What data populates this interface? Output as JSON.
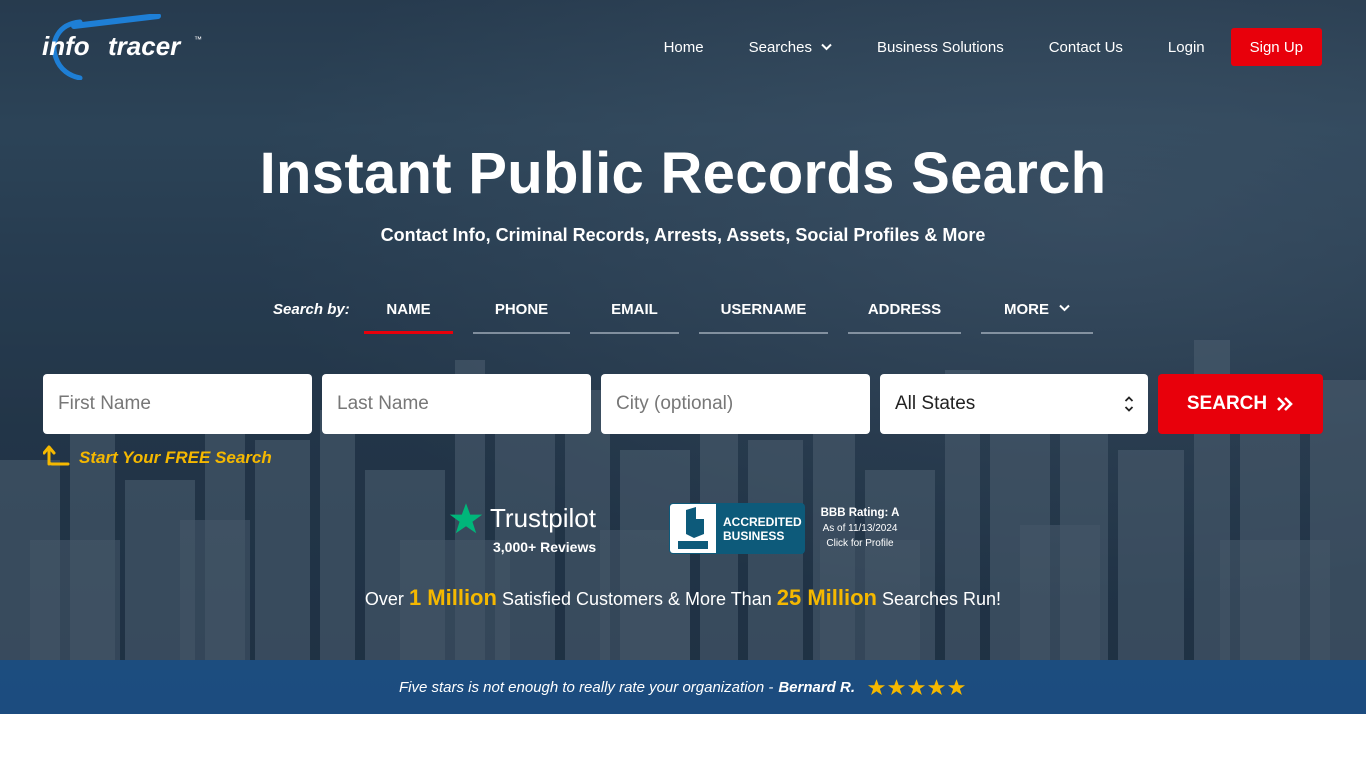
{
  "brand": {
    "logo_left": "info",
    "logo_right": "tracer",
    "tm": "™"
  },
  "nav": {
    "home": "Home",
    "searches": "Searches",
    "business": "Business Solutions",
    "contact": "Contact Us",
    "login": "Login",
    "signup": "Sign Up"
  },
  "hero": {
    "title": "Instant Public Records Search",
    "subtitle": "Contact Info, Criminal Records, Arrests, Assets, Social Profiles & More"
  },
  "search_tabs": {
    "label": "Search by:",
    "items": [
      "NAME",
      "PHONE",
      "EMAIL",
      "USERNAME",
      "ADDRESS",
      "MORE"
    ],
    "active": "NAME"
  },
  "form": {
    "first_name_placeholder": "First Name",
    "last_name_placeholder": "Last Name",
    "city_placeholder": "City (optional)",
    "state_selected": "All States",
    "search_label": "SEARCH",
    "free_hint": "Start Your FREE Search"
  },
  "trust": {
    "trustpilot_name": "Trustpilot",
    "trustpilot_reviews": "3,000+ Reviews",
    "bbb_line1": "ACCREDITED",
    "bbb_line2": "BUSINESS",
    "bbb_rating": "BBB Rating: A",
    "bbb_date": "As of 11/13/2024",
    "bbb_click": "Click for Profile"
  },
  "stats": {
    "pre": "Over ",
    "customers_big": "1 Million",
    "mid": " Satisfied Customers & More Than ",
    "searches_big": "25 Million",
    "post": " Searches Run!"
  },
  "testimonial": {
    "quote": "Five stars is not enough to really rate your organization - ",
    "author": "Bernard R.",
    "stars": 5
  },
  "colors": {
    "accent_red": "#e8000b",
    "highlight_yellow": "#f5b800",
    "trustpilot_green": "#00b67a",
    "bbb_blue": "#0d5a7a",
    "logo_blue": "#1e7fd6"
  }
}
